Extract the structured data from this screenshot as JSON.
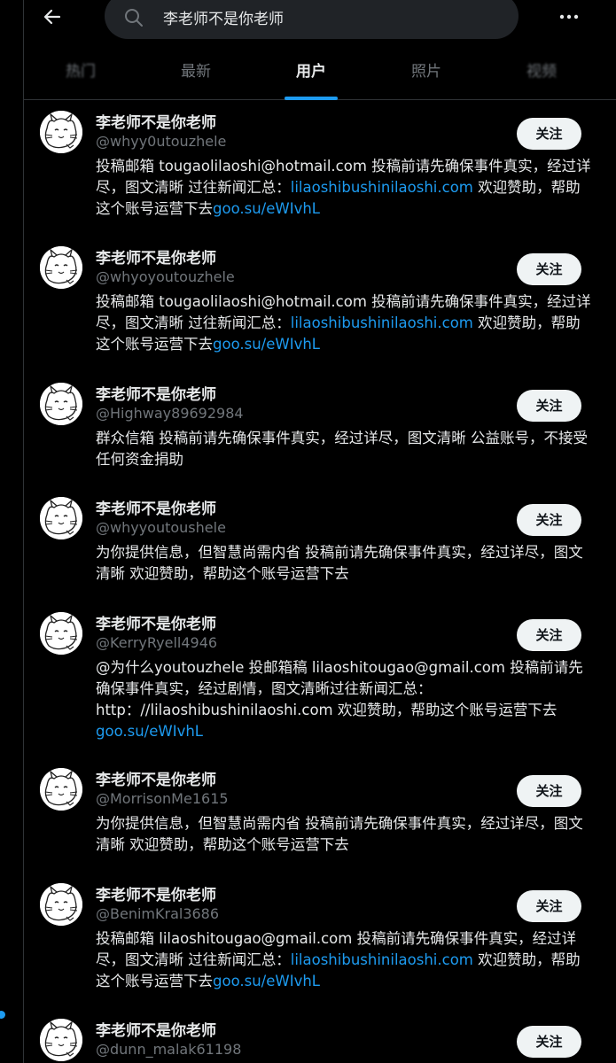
{
  "header": {
    "search_value": "李老师不是你老师",
    "back_icon": "arrow-left-icon",
    "search_icon": "search-icon",
    "more_icon": "more-horizontal-icon"
  },
  "tabs": [
    {
      "label": "热门"
    },
    {
      "label": "最新"
    },
    {
      "label": "用户"
    },
    {
      "label": "照片"
    },
    {
      "label": "视频"
    }
  ],
  "colors": {
    "accent": "#1d9bf0",
    "background": "#000000",
    "text": "#e7e9ea",
    "muted": "#71767b"
  },
  "users": [
    {
      "name": "李老师不是你老师",
      "handle": "@whyy0utouzhele",
      "follow_label": "关注",
      "bio": [
        {
          "t": "投稿邮箱 tougaolilaoshi@hotmail.com 投稿前请先确保事件真实，经过详尽，图文清晰 过往新闻汇总："
        },
        {
          "t": "lilaoshibushinilaoshi.com",
          "link": true
        },
        {
          "t": " 欢迎赞助，帮助这个账号运营下去"
        },
        {
          "t": "goo.su/eWIvhL",
          "link": true
        }
      ]
    },
    {
      "name": "李老师不是你老师",
      "handle": "@whyoyoutouzhele",
      "follow_label": "关注",
      "bio": [
        {
          "t": "投稿邮箱 tougaolilaoshi@hotmail.com 投稿前请先确保事件真实，经过详尽，图文清晰 过往新闻汇总："
        },
        {
          "t": "lilaoshibushinilaoshi.com",
          "link": true
        },
        {
          "t": " 欢迎赞助，帮助这个账号运营下去"
        },
        {
          "t": "goo.su/eWIvhL",
          "link": true
        }
      ]
    },
    {
      "name": "李老师不是你老师",
      "handle": "@Highway89692984",
      "follow_label": "关注",
      "bio": [
        {
          "t": "群众信箱 投稿前请先确保事件真实，经过详尽，图文清晰 公益账号，不接受任何资金捐助"
        }
      ]
    },
    {
      "name": "李老师不是你老师",
      "handle": "@whyyoutoushele",
      "follow_label": "关注",
      "bio": [
        {
          "t": "为你提供信息，但智慧尚需内省 投稿前请先确保事件真实，经过详尽，图文清晰 欢迎赞助，帮助这个账号运营下去"
        }
      ]
    },
    {
      "name": "李老师不是你老师",
      "handle": "@KerryRyell4946",
      "follow_label": "关注",
      "bio": [
        {
          "t": "@为什么youtouzhele 投邮箱稿 lilaoshitougao@gmail.com 投稿前请先确保事件真实，经过剧情，图文清晰过往新闻汇总：http：//lilaoshibushinilaoshi.com 欢迎赞助，帮助这个账号运营下去"
        },
        {
          "t": "goo.su/eWIvhL",
          "link": true
        }
      ]
    },
    {
      "name": "李老师不是你老师",
      "handle": "@MorrisonMe1615",
      "follow_label": "关注",
      "bio": [
        {
          "t": "为你提供信息，但智慧尚需内省 投稿前请先确保事件真实，经过详尽，图文清晰 欢迎赞助，帮助这个账号运营下去"
        }
      ]
    },
    {
      "name": "李老师不是你老师",
      "handle": "@BenimKral3686",
      "follow_label": "关注",
      "bio": [
        {
          "t": "投稿邮箱 lilaoshitougao@gmail.com 投稿前请先确保事件真实，经过详尽，图文清晰 过往新闻汇总："
        },
        {
          "t": "lilaoshibushinilaoshi.com",
          "link": true
        },
        {
          "t": " 欢迎赞助，帮助这个账号运营下去"
        },
        {
          "t": "goo.su/eWIvhL",
          "link": true
        }
      ]
    },
    {
      "name": "李老师不是你老师",
      "handle": "@dunn_malak61198",
      "follow_label": "关注",
      "bio": []
    }
  ]
}
